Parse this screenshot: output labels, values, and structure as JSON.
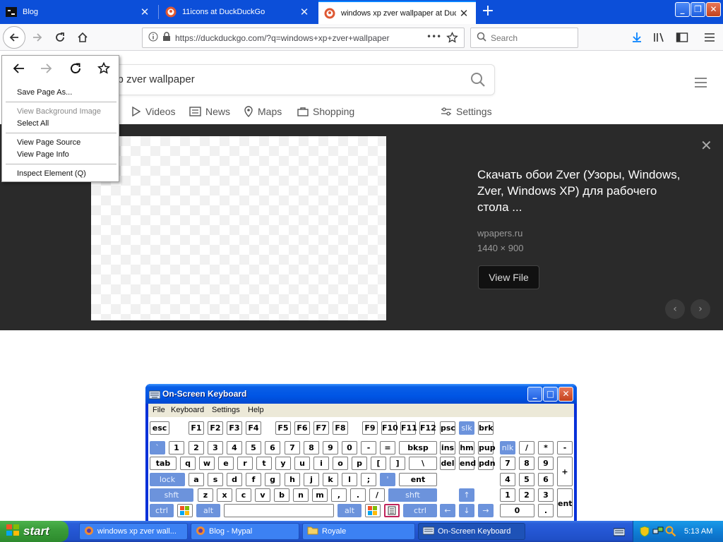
{
  "browser": {
    "tabs": [
      {
        "title": "Blog",
        "close": "✕"
      },
      {
        "title": "11icons at DuckDuckGo",
        "close": "✕"
      },
      {
        "title": "windows xp zver wallpaper at DuckDuckGo",
        "close": "✕"
      }
    ],
    "new_tab": "+",
    "window_controls": {
      "minimize": "_",
      "maximize": "❐",
      "close": "✕"
    },
    "url": "https://duckduckgo.com/?q=windows+xp+zver+wallpaper",
    "url_more": "•••",
    "search_placeholder": "Search"
  },
  "context_menu": {
    "items": [
      {
        "label": "Save Page As...",
        "enabled": true
      },
      {
        "label": "View Background Image",
        "enabled": false
      },
      {
        "label": "Select All",
        "enabled": true
      },
      {
        "label": "View Page Source",
        "enabled": true
      },
      {
        "label": "View Page Info",
        "enabled": true
      },
      {
        "label": "Inspect Element (Q)",
        "enabled": true
      }
    ]
  },
  "ddg": {
    "query": "xp zver wallpaper",
    "tabs": [
      "Videos",
      "News",
      "Maps",
      "Shopping",
      "Settings"
    ],
    "detail": {
      "title": "Скачать обои Zver (Узоры, Windows, Zver, Windows XP) для рабочего стола ...",
      "site": "wpapers.ru",
      "size": "1440 × 900",
      "button": "View File",
      "close": "✕",
      "prev": "‹",
      "next": "›"
    }
  },
  "osk": {
    "title": "On-Screen Keyboard",
    "menu": [
      "File",
      "Keyboard",
      "Settings",
      "Help"
    ],
    "controls": {
      "minimize": "_",
      "maximize": "□",
      "close": "✕"
    }
  },
  "taskbar": {
    "start": "start",
    "buttons": [
      {
        "label": "windows xp zver wall..."
      },
      {
        "label": "Blog - Mypal"
      },
      {
        "label": "Royale"
      },
      {
        "label": "On-Screen Keyboard"
      }
    ],
    "clock": "5:13 AM"
  },
  "colors": {
    "tabstrip": "#0c4fd9",
    "detail_bg": "#2a2a2a",
    "osk_frame": "#0831d9",
    "taskbar": "#2456d3",
    "start_green": "#3a9d3a"
  }
}
